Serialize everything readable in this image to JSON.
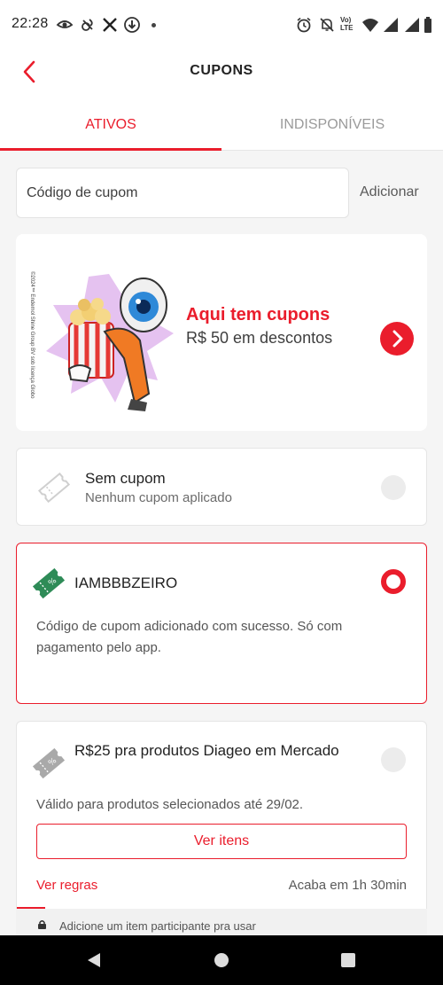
{
  "status_bar": {
    "time": "22:28",
    "lte_label": "Vo) LTE"
  },
  "header": {
    "title": "CUPONS"
  },
  "tabs": [
    {
      "label": "ATIVOS",
      "active": true
    },
    {
      "label": "INDISPONÍVEIS",
      "active": false
    }
  ],
  "coupon_input": {
    "placeholder": "Código de cupom",
    "value": "",
    "action_label": "Adicionar"
  },
  "banner": {
    "copyright": "©2024™ Endemol Shine Group BV sob licença Globo",
    "title": "Aqui tem cupons",
    "subtitle": "R$ 50 em descontos"
  },
  "coupons": [
    {
      "title": "Sem cupom",
      "subtitle": "Nenhum cupom aplicado",
      "selected": false,
      "icon": "ticket-outline-icon"
    },
    {
      "title": "IAMBBBZEIRO",
      "description": "Código de cupom adicionado com sucesso. Só com pagamento pelo app.",
      "selected": true,
      "icon": "green-ticket-icon"
    },
    {
      "title": "R$25 pra produtos Diageo em Mercado",
      "description": "Válido para produtos selecionados até 29/02.",
      "button_label": "Ver itens",
      "rules_label": "Ver regras",
      "expires": "Acaba em 1h 30min",
      "selected": false,
      "icon": "gray-ticket-icon",
      "time_progress": 0.07
    }
  ],
  "locked_note": "Adicione um item participante pra usar",
  "colors": {
    "accent": "#ea1d2c",
    "ticket_green": "#2e8b57"
  }
}
